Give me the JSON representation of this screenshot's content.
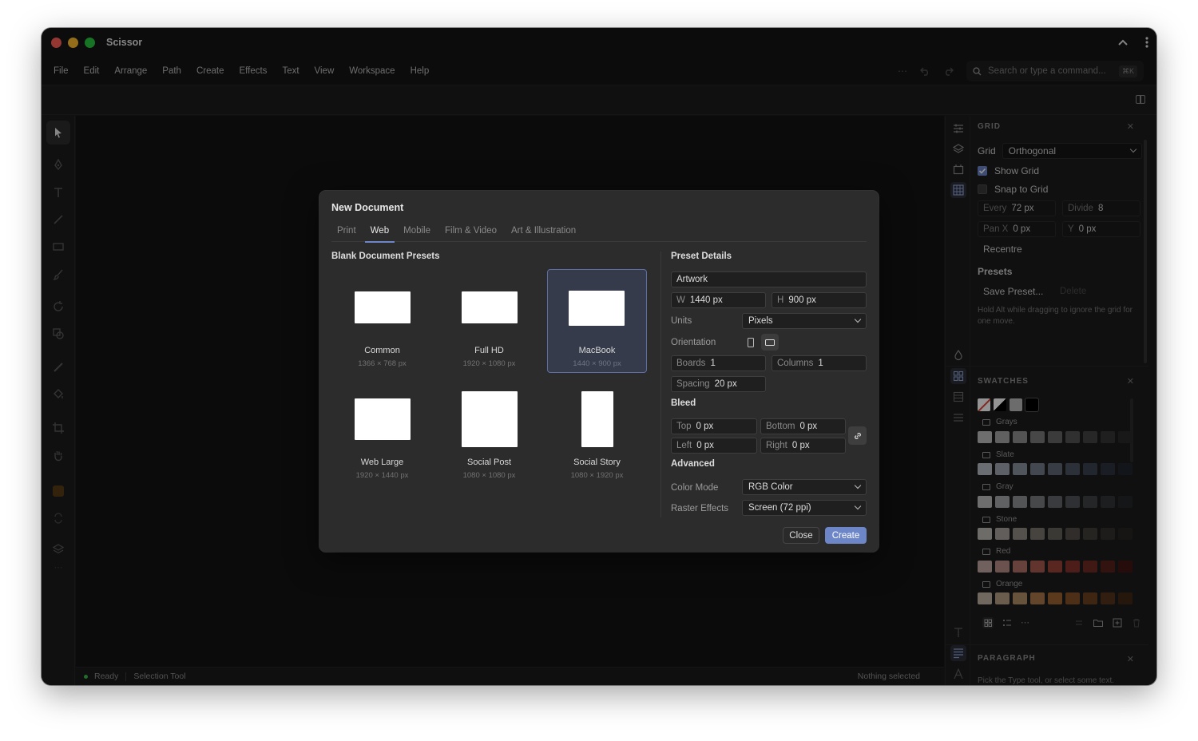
{
  "app": {
    "title": "Scissor"
  },
  "colors": {
    "accent": "#6d86c8",
    "close": "#ff5f57",
    "minimize": "#febc2e",
    "zoom": "#28c840",
    "status_ok": "#3fb950"
  },
  "menu": [
    "File",
    "Edit",
    "Arrange",
    "Path",
    "Create",
    "Effects",
    "Text",
    "View",
    "Workspace",
    "Help"
  ],
  "search": {
    "placeholder": "Search or type a command...",
    "shortcut": "⌘K"
  },
  "status": {
    "state": "Ready",
    "tool": "Selection Tool",
    "selection": "Nothing selected"
  },
  "grid_panel": {
    "heading": "GRID",
    "grid_label": "Grid",
    "grid_type": "Orthogonal",
    "show_grid": {
      "label": "Show Grid",
      "checked": true
    },
    "snap_to_grid": {
      "label": "Snap to Grid",
      "checked": false
    },
    "every": {
      "label": "Every",
      "value": "72 px"
    },
    "divide": {
      "label": "Divide",
      "value": "8"
    },
    "pan_x": {
      "label": "Pan X",
      "value": "0 px"
    },
    "pan_y": {
      "label": "Y",
      "value": "0 px"
    },
    "recentre": "Recentre",
    "presets_heading": "Presets",
    "save_preset": "Save Preset...",
    "delete": "Delete",
    "hint": "Hold Alt while dragging to ignore the grid for one move."
  },
  "swatches_panel": {
    "heading": "SWATCHES",
    "groups": [
      {
        "name": "Grays",
        "colors": [
          "#bdbdbd",
          "#a6a6a6",
          "#8f8f8f",
          "#7a7a7a",
          "#666666",
          "#545454",
          "#444444",
          "#363636",
          "#2a2a2a"
        ]
      },
      {
        "name": "Slate",
        "colors": [
          "#b7bcc4",
          "#a0a6b0",
          "#8a919d",
          "#747c8a",
          "#5f6877",
          "#4c5563",
          "#3b4350",
          "#2d333e",
          "#20252d"
        ]
      },
      {
        "name": "Gray",
        "colors": [
          "#bdbec0",
          "#a5a7aa",
          "#8f9195",
          "#7a7c80",
          "#65676b",
          "#525458",
          "#414346",
          "#323437",
          "#25262a"
        ]
      },
      {
        "name": "Stone",
        "colors": [
          "#bdbab6",
          "#a7a39d",
          "#918c85",
          "#7b766f",
          "#67625b",
          "#544f49",
          "#433f3a",
          "#34312d",
          "#272522"
        ]
      },
      {
        "name": "Red",
        "colors": [
          "#c2a7a4",
          "#b88e88",
          "#b17166",
          "#a85a4f",
          "#9c4238",
          "#86342c",
          "#6e2a24",
          "#58211c",
          "#431814"
        ]
      },
      {
        "name": "Orange",
        "colors": [
          "#c2b3a3",
          "#b9a186",
          "#b28d66",
          "#a9784a",
          "#9c6333",
          "#865228",
          "#6d4322",
          "#57351c",
          "#432916"
        ]
      }
    ]
  },
  "paragraph_panel": {
    "heading": "PARAGRAPH",
    "hint": "Pick the Type tool, or select some text."
  },
  "dialog": {
    "title": "New Document",
    "tabs": [
      "Print",
      "Web",
      "Mobile",
      "Film & Video",
      "Art & Illustration"
    ],
    "active_tab": "Web",
    "presets_heading": "Blank Document Presets",
    "presets": [
      {
        "name": "Common",
        "size": "1366 × 768 px"
      },
      {
        "name": "Full HD",
        "size": "1920 × 1080 px"
      },
      {
        "name": "MacBook",
        "size": "1440 × 900 px",
        "selected": true
      },
      {
        "name": "Web Large",
        "size": "1920 × 1440 px"
      },
      {
        "name": "Social Post",
        "size": "1080 × 1080 px"
      },
      {
        "name": "Social Story",
        "size": "1080 × 1920 px"
      }
    ],
    "details": {
      "heading": "Preset Details",
      "name": "Artwork",
      "width": {
        "label": "W",
        "value": "1440 px"
      },
      "height": {
        "label": "H",
        "value": "900 px"
      },
      "units_label": "Units",
      "units": "Pixels",
      "orientation_label": "Orientation",
      "boards": {
        "label": "Boards",
        "value": "1"
      },
      "columns": {
        "label": "Columns",
        "value": "1"
      },
      "spacing": {
        "label": "Spacing",
        "value": "20 px"
      },
      "bleed_heading": "Bleed",
      "top": {
        "label": "Top",
        "value": "0 px"
      },
      "bottom": {
        "label": "Bottom",
        "value": "0 px"
      },
      "left": {
        "label": "Left",
        "value": "0 px"
      },
      "right": {
        "label": "Right",
        "value": "0 px"
      },
      "advanced_heading": "Advanced",
      "color_mode_label": "Color Mode",
      "color_mode": "RGB Color",
      "raster_label": "Raster Effects",
      "raster": "Screen (72 ppi)"
    },
    "close_label": "Close",
    "create_label": "Create"
  }
}
